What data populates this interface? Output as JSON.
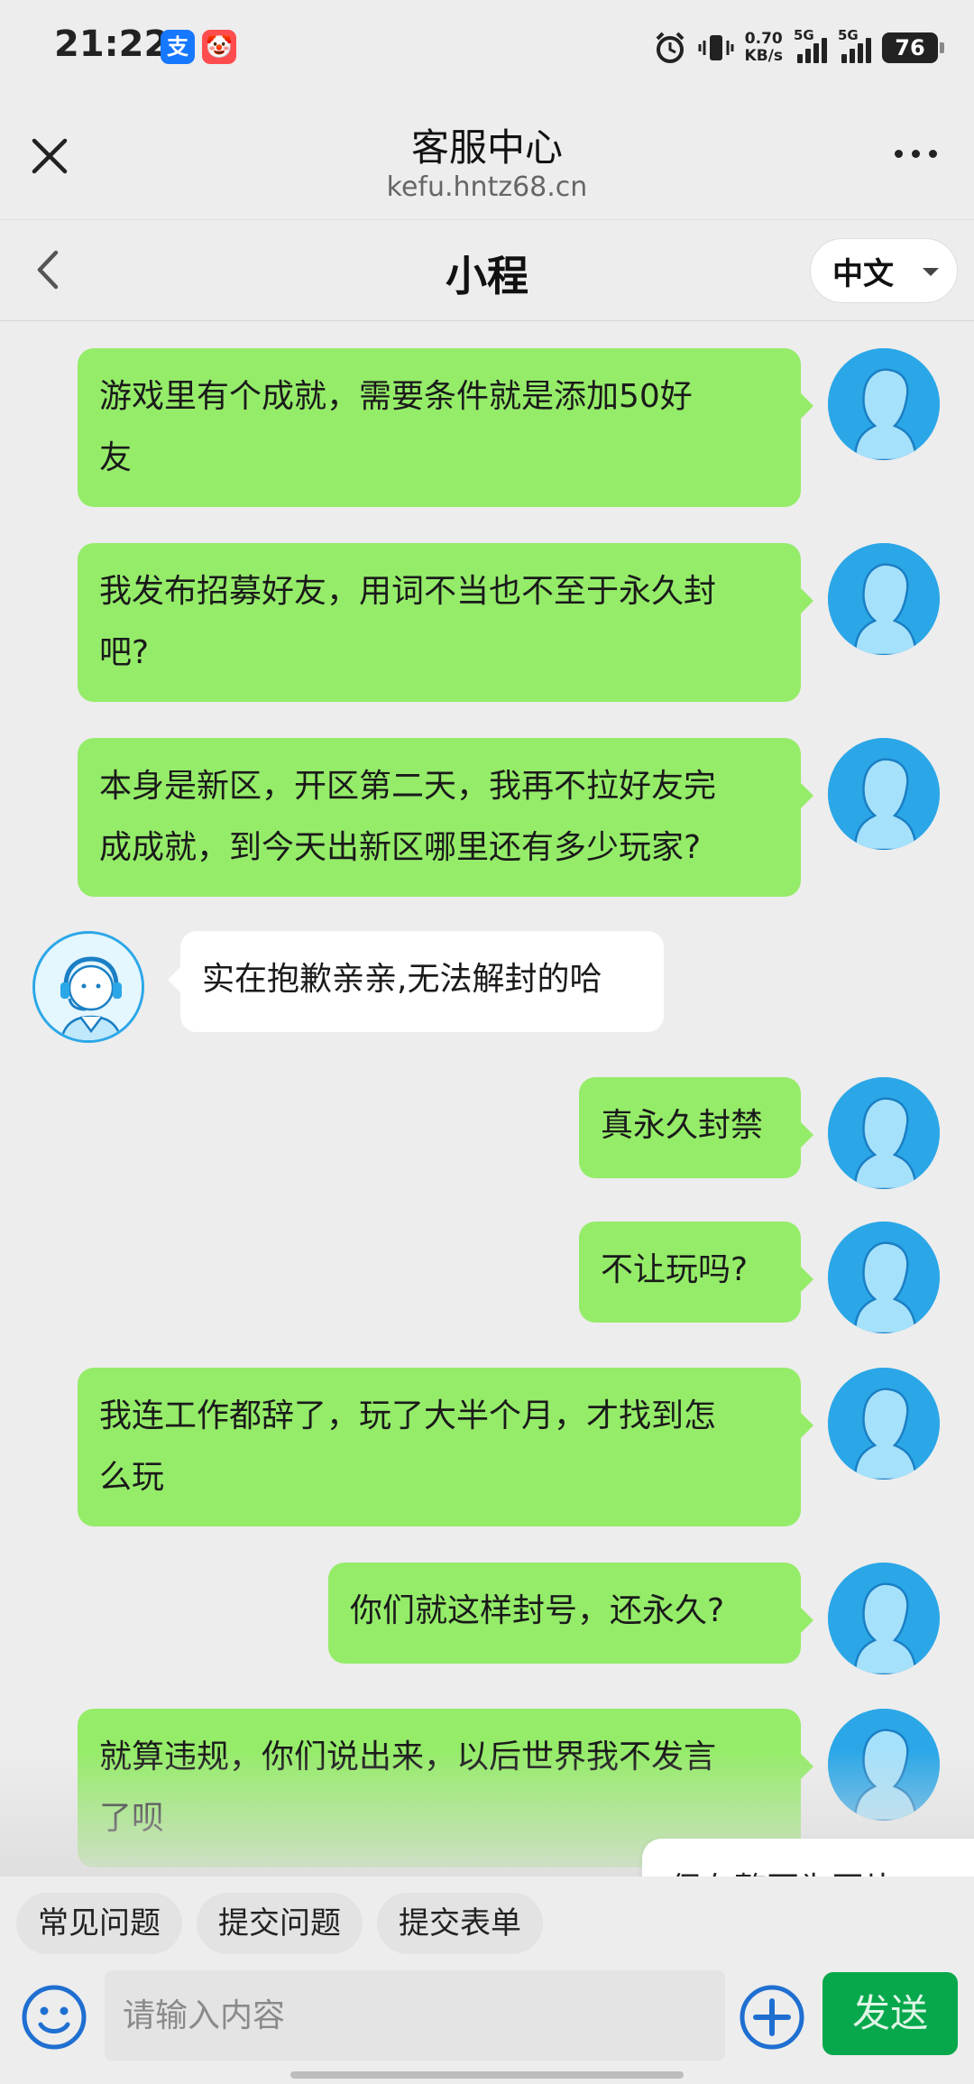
{
  "status_bar": {
    "time": "21:22",
    "app_badges": [
      "支",
      "🤡"
    ],
    "speed_value": "0.70",
    "speed_unit": "KB/s",
    "network_1": "5G",
    "network_2": "5G",
    "battery": "76"
  },
  "browser": {
    "title": "客服中心",
    "url": "kefu.hntz68.cn"
  },
  "chat": {
    "title": "小程",
    "language": "中文"
  },
  "messages": [
    {
      "sender": "user",
      "lines": [
        "游戏里有个成就，需要条件就是添加50好",
        "友"
      ]
    },
    {
      "sender": "user",
      "lines": [
        "我发布招募好友，用词不当也不至于永久封",
        "吧?"
      ]
    },
    {
      "sender": "user",
      "lines": [
        "本身是新区，开区第二天，我再不拉好友完",
        "成成就，到今天出新区哪里还有多少玩家?"
      ]
    },
    {
      "sender": "agent",
      "lines": [
        "实在抱歉亲亲,无法解封的哈"
      ]
    },
    {
      "sender": "user",
      "lines": [
        "真永久封禁"
      ]
    },
    {
      "sender": "user",
      "lines": [
        "不让玩吗?"
      ]
    },
    {
      "sender": "user",
      "lines": [
        "我连工作都辞了，玩了大半个月，才找到怎",
        "么玩"
      ]
    },
    {
      "sender": "user",
      "lines": [
        "你们就这样封号，还永久?"
      ]
    },
    {
      "sender": "user",
      "lines": [
        "就算违规，你们说出来，以后世界我不发言",
        "了呗"
      ]
    }
  ],
  "save_page_label": "保存整页为图片 >",
  "quick_actions": [
    "常见问题",
    "提交问题",
    "提交表单"
  ],
  "input": {
    "placeholder": "请输入内容",
    "send_label": "发送"
  },
  "colors": {
    "user_bubble": "#95ec69",
    "agent_bubble": "#ffffff",
    "send_button": "#07a84c",
    "avatar_blue": "#2ba7e8"
  }
}
